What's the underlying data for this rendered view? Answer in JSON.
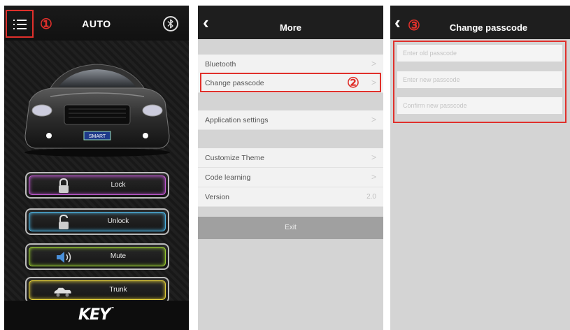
{
  "home": {
    "title": "AUTO",
    "menu_marker": "①",
    "plate": "SMART",
    "buttons": [
      {
        "label": "Lock",
        "icon": "lock-icon",
        "color": "#c55bd6"
      },
      {
        "label": "Unlock",
        "icon": "unlock-icon",
        "color": "#4fb8e8"
      },
      {
        "label": "Mute",
        "icon": "speaker-icon",
        "color": "#9acd32"
      },
      {
        "label": "Trunk",
        "icon": "car-trunk-icon",
        "color": "#e6d23a"
      }
    ],
    "logo": "KEY",
    "logo_tm": "™"
  },
  "more": {
    "title": "More",
    "back_icon": "chevron-left-icon",
    "items": [
      {
        "label": "Bluetooth",
        "chevron": ">"
      },
      {
        "label": "Change passcode",
        "chevron": ">"
      },
      {
        "label": "Application settings",
        "chevron": ">"
      },
      {
        "label": "Customize Theme",
        "chevron": ">"
      },
      {
        "label": "Code learning",
        "chevron": ">"
      },
      {
        "label": "Version",
        "value": "2.0"
      }
    ],
    "change_marker": "②",
    "exit_label": "Exit"
  },
  "passcode": {
    "title": "Change passcode",
    "back_icon": "chevron-left-icon",
    "marker": "③",
    "fields": [
      {
        "placeholder": "Enter old passcode",
        "value": ""
      },
      {
        "placeholder": "Enter new passcode",
        "value": ""
      },
      {
        "placeholder": "Confirm new passcode",
        "value": ""
      }
    ]
  },
  "colors": {
    "annotation": "#e0302b",
    "nav_bar": "#1e1e1e",
    "group_gap": "#d4d4d4"
  }
}
